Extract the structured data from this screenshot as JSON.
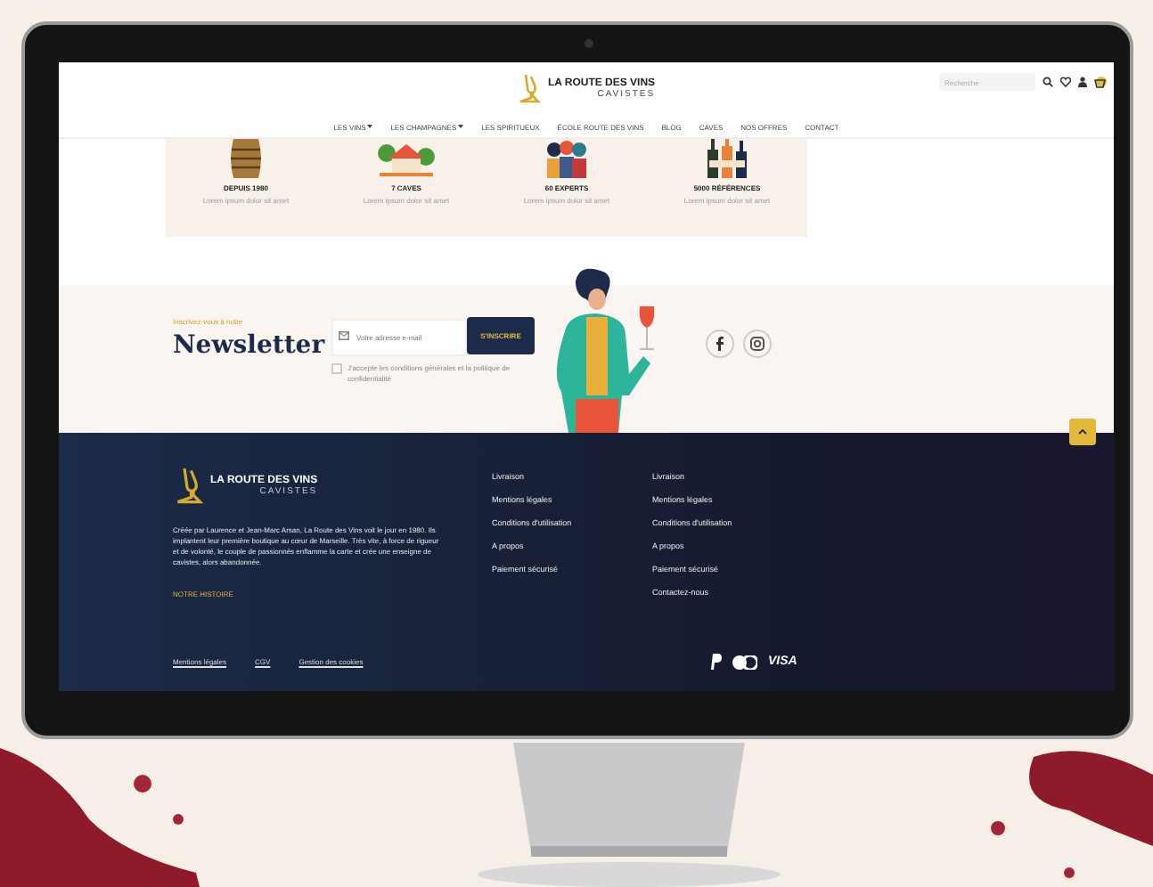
{
  "header": {
    "logo": {
      "title": "LA ROUTE DES VINS",
      "subtitle": "CAVISTES"
    },
    "search": {
      "placeholder": "Recherche"
    },
    "nav": [
      {
        "label": "LES VINS",
        "dropdown": true
      },
      {
        "label": "LES CHAMPAGNES",
        "dropdown": true
      },
      {
        "label": "LES SPIRITUEUX",
        "dropdown": false
      },
      {
        "label": "ÉCOLE ROUTE DES VINS",
        "dropdown": false
      },
      {
        "label": "BLOG",
        "dropdown": false
      },
      {
        "label": "CAVES",
        "dropdown": false
      },
      {
        "label": "NOS OFFRES",
        "dropdown": false
      },
      {
        "label": "CONTACT",
        "dropdown": false
      }
    ]
  },
  "stats": [
    {
      "kind": "barrel",
      "title": "DEPUIS 1980",
      "text": "Lorem ipsum dolor sit amet"
    },
    {
      "kind": "house",
      "title": "7 CAVES",
      "text": "Lorem ipsum dolor sit amet"
    },
    {
      "kind": "people",
      "title": "60 EXPERTS",
      "text": "Lorem ipsum dolor sit amet"
    },
    {
      "kind": "bottles",
      "title": "5000 RÉFÉRENCES",
      "text": "Lorem ipsum dolor sit amet"
    }
  ],
  "newsletter": {
    "eyebrow": "Inscrivez-vous à notre",
    "title": "Newsletter",
    "email": {
      "placeholder": "Votre adresse e-mail"
    },
    "button": "S'INSCRIRE",
    "consent": {
      "text": "J'accepte les conditions générales et la politique de confidentialité",
      "checked": false
    },
    "social": [
      {
        "kind": "facebook"
      },
      {
        "kind": "instagram"
      }
    ]
  },
  "footer": {
    "logo": {
      "title": "LA ROUTE DES VINS",
      "subtitle": "CAVISTES"
    },
    "description": "Créée par Laurence et Jean-Marc Arsan, La Route des Vins voit le jour en 1980. Ils implantent leur première boutique au cœur de Marseille. Très vite, à force de rigueur et de volonté, le couple de passionnés enflamme la carte et crée une enseigne de cavistes, alors abandonnée.",
    "story_link": "NOTRE HISTOIRE",
    "columns": [
      [
        "Livraison",
        "Mentions légales",
        "Conditions d'utilisation",
        "A propos",
        "Paiement sécurisé"
      ],
      [
        "Livraison",
        "Mentions légales",
        "Conditions d'utilisation",
        "A propos",
        "Paiement sécurisé",
        "Contactez-nous"
      ]
    ],
    "bottom_links": [
      "Mentions légales",
      "CGV",
      "Gestion des cookies"
    ],
    "payments": [
      {
        "kind": "paypal"
      },
      {
        "kind": "mastercard"
      },
      {
        "kind": "text",
        "label": "VISA"
      }
    ]
  }
}
